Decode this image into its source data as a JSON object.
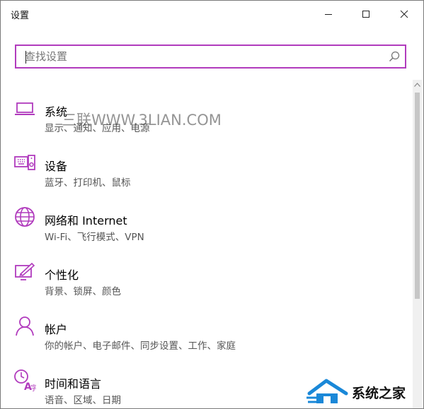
{
  "window": {
    "title": "设置"
  },
  "search": {
    "placeholder": "查找设置",
    "value": ""
  },
  "accent_color": "#b13bbd",
  "categories": [
    {
      "name": "系统",
      "desc": "显示、通知、应用、电源",
      "icon": "laptop-icon"
    },
    {
      "name": "设备",
      "desc": "蓝牙、打印机、鼠标",
      "icon": "devices-icon"
    },
    {
      "name": "网络和 Internet",
      "desc": "Wi-Fi、飞行模式、VPN",
      "icon": "globe-icon"
    },
    {
      "name": "个性化",
      "desc": "背景、锁屏、颜色",
      "icon": "personalize-icon"
    },
    {
      "name": "帐户",
      "desc": "你的帐户、电子邮件、同步设置、工作、家庭",
      "icon": "person-icon"
    },
    {
      "name": "时间和语言",
      "desc": "语音、区域、日期",
      "icon": "time-language-icon"
    }
  ],
  "watermark": {
    "text": "三联WWW.3LIAN.COM",
    "logo_text": "系统之家"
  }
}
